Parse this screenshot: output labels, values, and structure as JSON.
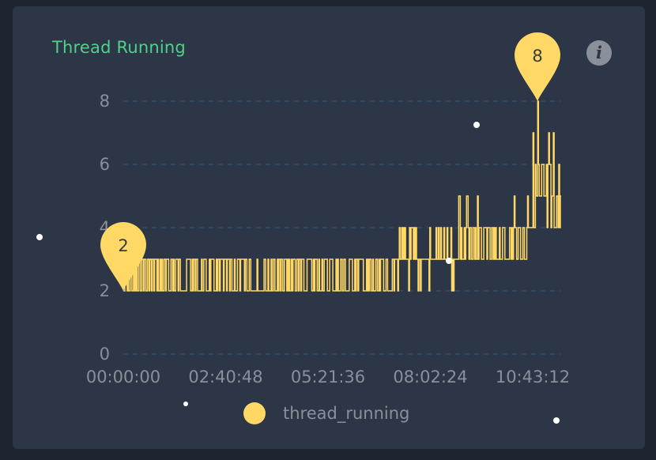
{
  "widget": {
    "title": "Thread Running",
    "info_icon": "info-icon"
  },
  "colors": {
    "background": "#1e2430",
    "card": "#2d3646",
    "title": "#4fd18b",
    "series": "#ffd865",
    "axis_text": "#8a9099",
    "grid": "#2e5178"
  },
  "chart_data": {
    "type": "line",
    "title": "Thread Running",
    "xlabel": "",
    "ylabel": "",
    "x_ticks": [
      "00:00:00",
      "02:40:48",
      "05:21:36",
      "08:02:24",
      "10:43:12"
    ],
    "y_ticks": [
      "0",
      "2",
      "4",
      "6",
      "8"
    ],
    "ylim": [
      0,
      8
    ],
    "grid": "horizontal dashed",
    "legend_position": "bottom",
    "series": [
      {
        "name": "thread_running",
        "color": "#ffd865",
        "baseline_levels": [
          2,
          3,
          4
        ],
        "markers": [
          {
            "label": "2",
            "type": "min",
            "x": "00:00:00",
            "value": 2
          },
          {
            "label": "8",
            "type": "max",
            "x": "10:43:12",
            "value": 8
          }
        ]
      }
    ]
  }
}
